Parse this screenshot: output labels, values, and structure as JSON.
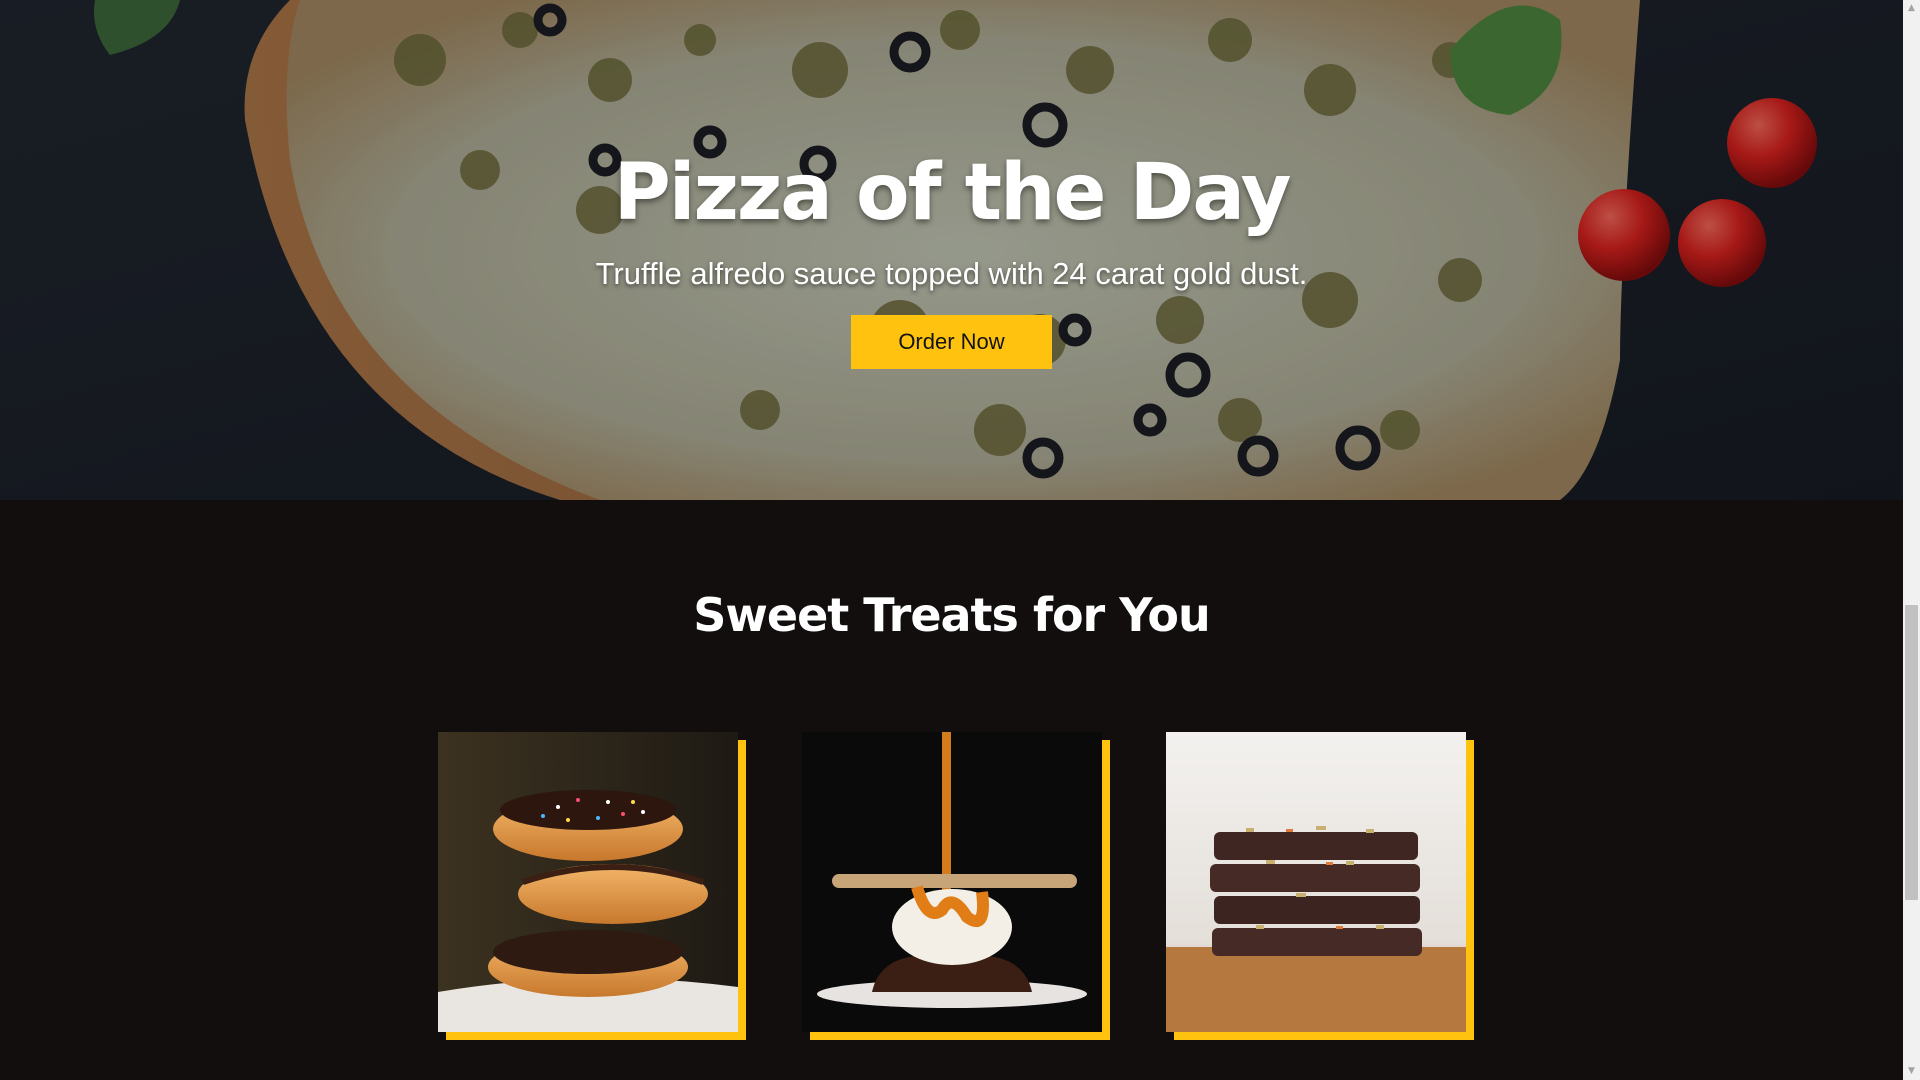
{
  "hero": {
    "title": "Pizza of the Day",
    "subtitle": "Truffle alfredo sauce topped with 24 carat gold dust.",
    "button_label": "Order Now"
  },
  "treats": {
    "title": "Sweet Treats for You",
    "items": [
      {
        "image": "stacked-donuts-image"
      },
      {
        "image": "caramel-ice-cream-image"
      },
      {
        "image": "stacked-brownies-image"
      }
    ]
  },
  "colors": {
    "accent": "#ffc20e",
    "page_background": "#130e0e",
    "hero_background": "#1b2129",
    "heading_text": "#ffffff"
  },
  "icons": {
    "scroll_up": "triangle-up",
    "scroll_down": "triangle-down"
  }
}
